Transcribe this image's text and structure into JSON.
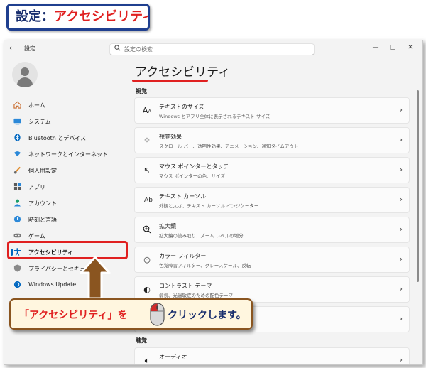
{
  "banner": {
    "prefix": "設定：",
    "title": "アクセシビリティ"
  },
  "window": {
    "app_title": "設定",
    "search_placeholder": "設定の検索",
    "controls": {
      "minimize": "—",
      "maximize": "□",
      "close": "✕"
    }
  },
  "sidebar": {
    "items": [
      {
        "label": "ホーム",
        "icon": "home-icon"
      },
      {
        "label": "システム",
        "icon": "system-icon"
      },
      {
        "label": "Bluetooth とデバイス",
        "icon": "bluetooth-icon"
      },
      {
        "label": "ネットワークとインターネット",
        "icon": "network-icon"
      },
      {
        "label": "個人用設定",
        "icon": "personalization-icon"
      },
      {
        "label": "アプリ",
        "icon": "apps-icon"
      },
      {
        "label": "アカウント",
        "icon": "account-icon"
      },
      {
        "label": "時刻と言語",
        "icon": "time-language-icon"
      },
      {
        "label": "ゲーム",
        "icon": "gaming-icon"
      },
      {
        "label": "アクセシビリティ",
        "icon": "accessibility-icon",
        "active": true
      },
      {
        "label": "プライバシーとセキュリティ",
        "icon": "shield-icon"
      },
      {
        "label": "Windows Update",
        "icon": "windows-update-icon"
      }
    ]
  },
  "main": {
    "title": "アクセシビリティ",
    "sections": [
      {
        "label": "視覚",
        "cards": [
          {
            "title": "テキストのサイズ",
            "subtitle": "Windows とアプリ全体に表示されるテキスト サイズ",
            "icon": "text-size-icon"
          },
          {
            "title": "視覚効果",
            "subtitle": "スクロール バー、透明性効果、アニメーション、通知タイムアウト",
            "icon": "visual-effects-icon"
          },
          {
            "title": "マウス ポインターとタッチ",
            "subtitle": "マウス ポインターの色、サイズ",
            "icon": "mouse-pointer-icon"
          },
          {
            "title": "テキスト カーソル",
            "subtitle": "外観と太さ、テキスト カーソル インジケーター",
            "icon": "text-cursor-icon"
          },
          {
            "title": "拡大鏡",
            "subtitle": "拡大鏡の読み取り、ズーム レベルの増分",
            "icon": "magnifier-icon"
          },
          {
            "title": "カラー フィルター",
            "subtitle": "色覚障害フィルター、グレースケール、反転",
            "icon": "color-filter-icon"
          },
          {
            "title": "コントラスト テーマ",
            "subtitle": "弱視、光過敏症のための配色テーマ",
            "icon": "contrast-icon"
          },
          {
            "title": "",
            "subtitle": "",
            "icon": ""
          }
        ]
      },
      {
        "label": "聴覚",
        "cards": [
          {
            "title": "オーディオ",
            "subtitle": "",
            "icon": "audio-icon"
          }
        ]
      }
    ]
  },
  "callout": {
    "text_before": "「アクセシビリティ」を",
    "text_after": "クリックします。",
    "colors": {
      "quote": "#e02020",
      "body": "#1a2f6e"
    }
  },
  "colors": {
    "accent": "#0067c0",
    "highlight": "#e02020",
    "banner_border": "#1f3f8f"
  }
}
